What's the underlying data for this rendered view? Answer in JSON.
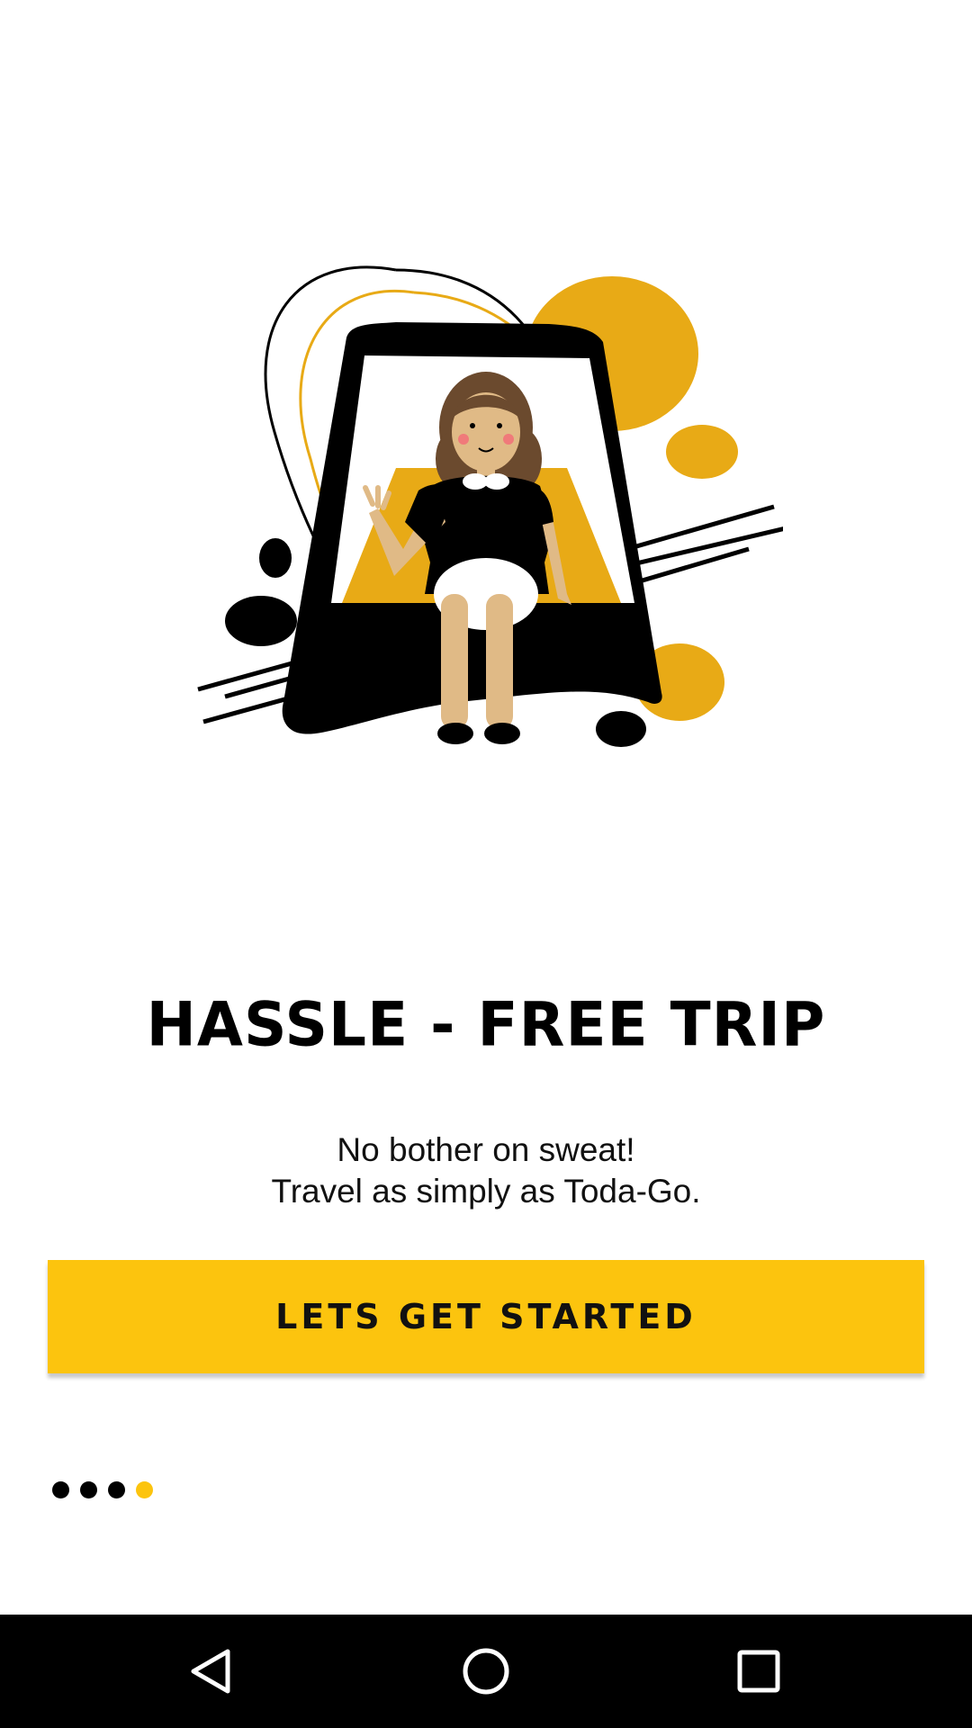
{
  "onboarding": {
    "title": "HASSLE - FREE TRIP",
    "subtitle_line1": "No bother on sweat!",
    "subtitle_line2": "Travel as simply as Toda-Go.",
    "cta_label": "LETS GET STARTED",
    "page_indicator": {
      "total": 4,
      "current": 4
    }
  },
  "colors": {
    "accent": "#FCC40E",
    "illustration_yellow": "#E8AA16",
    "text": "#000000",
    "background": "#FFFFFF",
    "navbar": "#000000"
  },
  "illustration": {
    "icon": "girl-in-tricycle-illustration"
  },
  "navbar": {
    "back_icon": "back-triangle-icon",
    "home_icon": "home-circle-icon",
    "recents_icon": "recents-square-icon"
  }
}
